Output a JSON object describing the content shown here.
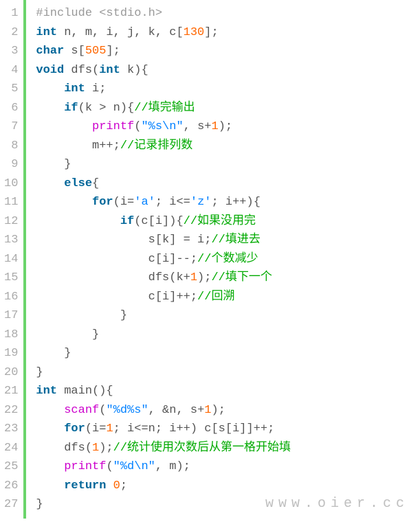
{
  "watermark": "www.oier.cc",
  "lines": [
    {
      "n": "1",
      "seg": [
        [
          "pp",
          "#include <stdio.h>"
        ]
      ]
    },
    {
      "n": "2",
      "seg": [
        [
          "kw",
          "int"
        ],
        [
          "pl",
          " n, m, i, j, k, c["
        ],
        [
          "num",
          "130"
        ],
        [
          "pl",
          "];"
        ]
      ]
    },
    {
      "n": "3",
      "seg": [
        [
          "kw",
          "char"
        ],
        [
          "pl",
          " s["
        ],
        [
          "num",
          "505"
        ],
        [
          "pl",
          "];"
        ]
      ]
    },
    {
      "n": "4",
      "seg": [
        [
          "kw",
          "void"
        ],
        [
          "pl",
          " dfs("
        ],
        [
          "kw",
          "int"
        ],
        [
          "pl",
          " k){"
        ]
      ]
    },
    {
      "n": "5",
      "seg": [
        [
          "pl",
          "    "
        ],
        [
          "kw",
          "int"
        ],
        [
          "pl",
          " i;"
        ]
      ]
    },
    {
      "n": "6",
      "seg": [
        [
          "pl",
          "    "
        ],
        [
          "kw",
          "if"
        ],
        [
          "pl",
          "(k > n){"
        ],
        [
          "cmt",
          "//填完输出"
        ]
      ]
    },
    {
      "n": "7",
      "seg": [
        [
          "pl",
          "        "
        ],
        [
          "fn",
          "printf"
        ],
        [
          "pl",
          "("
        ],
        [
          "str",
          "\"%s\\n\""
        ],
        [
          "pl",
          ", s+"
        ],
        [
          "num",
          "1"
        ],
        [
          "pl",
          ");"
        ]
      ]
    },
    {
      "n": "8",
      "seg": [
        [
          "pl",
          "        m++;"
        ],
        [
          "cmt",
          "//记录排列数"
        ]
      ]
    },
    {
      "n": "9",
      "seg": [
        [
          "pl",
          "    }"
        ]
      ]
    },
    {
      "n": "10",
      "seg": [
        [
          "pl",
          "    "
        ],
        [
          "kw",
          "else"
        ],
        [
          "pl",
          "{"
        ]
      ]
    },
    {
      "n": "11",
      "seg": [
        [
          "pl",
          "        "
        ],
        [
          "kw",
          "for"
        ],
        [
          "pl",
          "(i="
        ],
        [
          "chr",
          "'a'"
        ],
        [
          "pl",
          "; i<="
        ],
        [
          "chr",
          "'z'"
        ],
        [
          "pl",
          "; i++){"
        ]
      ]
    },
    {
      "n": "12",
      "seg": [
        [
          "pl",
          "            "
        ],
        [
          "kw",
          "if"
        ],
        [
          "pl",
          "(c[i]){"
        ],
        [
          "cmt",
          "//如果没用完"
        ]
      ]
    },
    {
      "n": "13",
      "seg": [
        [
          "pl",
          "                s[k] = i;"
        ],
        [
          "cmt",
          "//填进去"
        ]
      ]
    },
    {
      "n": "14",
      "seg": [
        [
          "pl",
          "                c[i]--;"
        ],
        [
          "cmt",
          "//个数减少"
        ]
      ]
    },
    {
      "n": "15",
      "seg": [
        [
          "pl",
          "                dfs(k+"
        ],
        [
          "num",
          "1"
        ],
        [
          "pl",
          ");"
        ],
        [
          "cmt",
          "//填下一个"
        ]
      ]
    },
    {
      "n": "16",
      "seg": [
        [
          "pl",
          "                c[i]++;"
        ],
        [
          "cmt",
          "//回溯"
        ]
      ]
    },
    {
      "n": "17",
      "seg": [
        [
          "pl",
          "            }"
        ]
      ]
    },
    {
      "n": "18",
      "seg": [
        [
          "pl",
          "        }"
        ]
      ]
    },
    {
      "n": "19",
      "seg": [
        [
          "pl",
          "    }"
        ]
      ]
    },
    {
      "n": "20",
      "seg": [
        [
          "pl",
          "}"
        ]
      ]
    },
    {
      "n": "21",
      "seg": [
        [
          "kw",
          "int"
        ],
        [
          "pl",
          " main(){"
        ]
      ]
    },
    {
      "n": "22",
      "seg": [
        [
          "pl",
          "    "
        ],
        [
          "fn",
          "scanf"
        ],
        [
          "pl",
          "("
        ],
        [
          "str",
          "\"%d%s\""
        ],
        [
          "pl",
          ", &n, s+"
        ],
        [
          "num",
          "1"
        ],
        [
          "pl",
          ");"
        ]
      ]
    },
    {
      "n": "23",
      "seg": [
        [
          "pl",
          "    "
        ],
        [
          "kw",
          "for"
        ],
        [
          "pl",
          "(i="
        ],
        [
          "num",
          "1"
        ],
        [
          "pl",
          "; i<=n; i++) c[s[i]]++;"
        ]
      ]
    },
    {
      "n": "24",
      "seg": [
        [
          "pl",
          "    dfs("
        ],
        [
          "num",
          "1"
        ],
        [
          "pl",
          ");"
        ],
        [
          "cmt",
          "//统计使用次数后从第一格开始填"
        ]
      ]
    },
    {
      "n": "25",
      "seg": [
        [
          "pl",
          "    "
        ],
        [
          "fn",
          "printf"
        ],
        [
          "pl",
          "("
        ],
        [
          "str",
          "\"%d\\n\""
        ],
        [
          "pl",
          ", m);"
        ]
      ]
    },
    {
      "n": "26",
      "seg": [
        [
          "pl",
          "    "
        ],
        [
          "kw",
          "return"
        ],
        [
          "pl",
          " "
        ],
        [
          "num",
          "0"
        ],
        [
          "pl",
          ";"
        ]
      ]
    },
    {
      "n": "27",
      "seg": [
        [
          "pl",
          "}"
        ]
      ]
    }
  ]
}
